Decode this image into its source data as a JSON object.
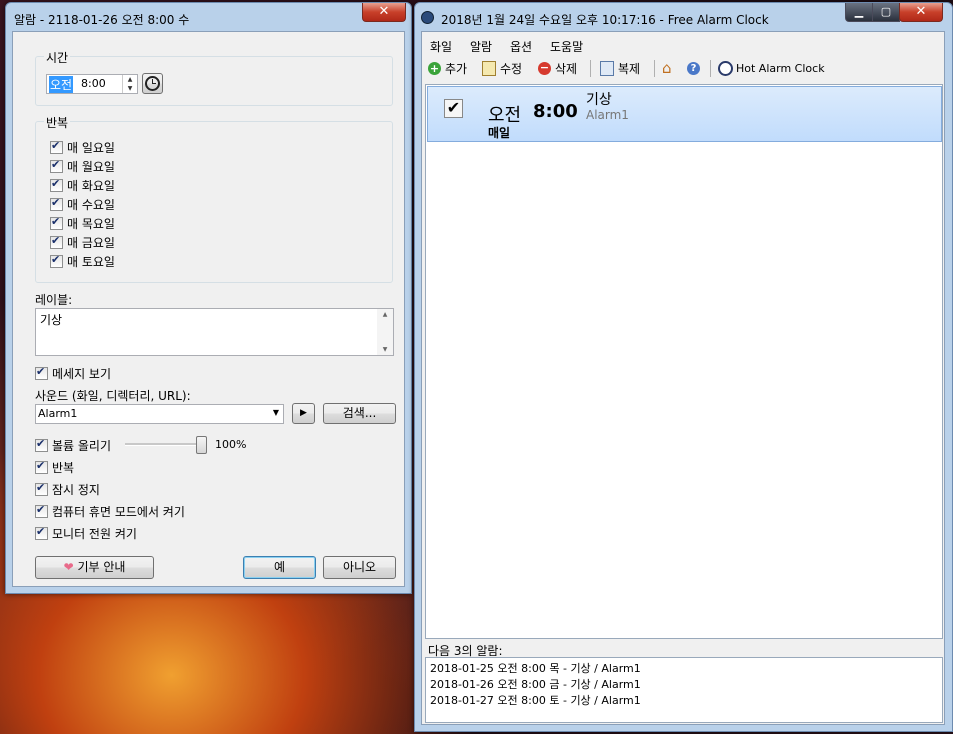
{
  "dialog": {
    "title": "알람 - 2118-01-26 오전 8:00 수",
    "close": "x",
    "time_group": "시간",
    "ampm": "오전",
    "time": "8:00",
    "repeat_group": "반복",
    "days": [
      "매 일요일",
      "매 월요일",
      "매 화요일",
      "매 수요일",
      "매 목요일",
      "매 금요일",
      "매 토요일"
    ],
    "label_caption": "레이블:",
    "label_value": "기상",
    "show_message": "메세지 보기",
    "sound_caption": "사운드 (화일, 디렉터리, URL):",
    "sound_value": "Alarm1",
    "browse": "검색...",
    "volume_up": "볼륨 올리기",
    "volume_pct": "100%",
    "volume_level": 1.0,
    "repeat": "반복",
    "snooze": "잠시 정지",
    "wake_pc": "컴퓨터 휴면 모드에서 켜기",
    "monitor_on": "모니터 전원 켜기",
    "donate": "기부 안내",
    "ok": "예",
    "cancel": "아니오"
  },
  "main": {
    "title": "2018년 1월 24일 수요일 오후 10:17:16 - Free Alarm Clock",
    "menu": [
      "화일",
      "알람",
      "옵션",
      "도움말"
    ],
    "toolbar": {
      "add": "추가",
      "edit": "수정",
      "delete": "삭제",
      "copy": "복제",
      "hot": "Hot Alarm Clock"
    },
    "alarm": {
      "ampm": "오전",
      "time": "8:00",
      "repeat": "매일",
      "label": "기상",
      "sound": "Alarm1"
    },
    "next_caption": "다음 3의 알람:",
    "next": [
      "2018-01-25 오전 8:00 목 - 기상 / Alarm1",
      "2018-01-26 오전 8:00 금 - 기상 / Alarm1",
      "2018-01-27 오전 8:00 토 - 기상 / Alarm1"
    ]
  },
  "colors": {
    "selection": "#cfe3fb",
    "titlebar": "#b9d1ea"
  }
}
